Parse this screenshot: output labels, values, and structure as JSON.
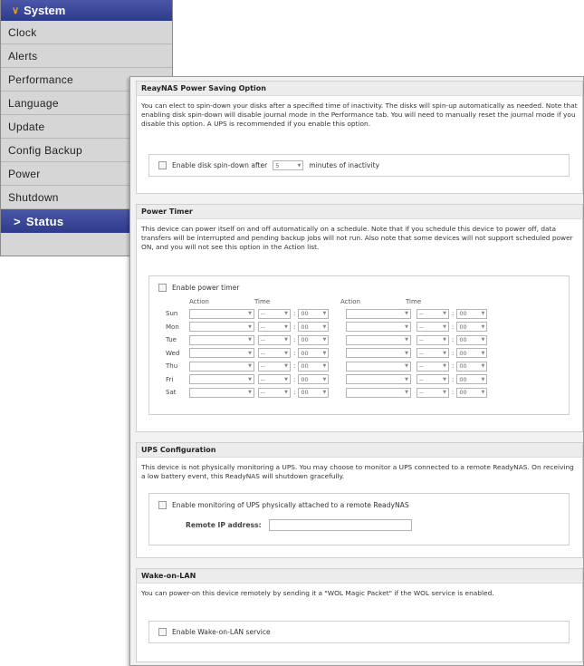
{
  "menu": {
    "header": "System",
    "items": [
      "Clock",
      "Alerts",
      "Performance",
      "Language",
      "Update",
      "Config Backup",
      "Power",
      "Shutdown"
    ],
    "active": "Status"
  },
  "power_saving": {
    "title": "ReayNAS Power Saving Option",
    "description": "You can elect to spin-down your disks after a specified time of inactivity. The disks will spin-up automatically as needed. Note that enabling disk spin-down will disable journal mode in the Performance tab. You will need to manually reset the journal mode if you disable this option. A UPS is recommended if you enable this option.",
    "checkbox_label_pre": "Enable disk spin-down after",
    "minutes_value": "5",
    "checkbox_label_post": "minutes of inactivity"
  },
  "power_timer": {
    "title": "Power Timer",
    "description": "This device can power itself on and off automatically on a schedule. Note that if you schedule this device to power off, data transfers will be interrupted and pending backup jobs will not run. Also note that some devices will not support scheduled power ON, and you will not see this option in the Action list.",
    "checkbox_label": "Enable power timer",
    "col_action": "Action",
    "col_time": "Time",
    "hour_placeholder": "--",
    "minute_value": "00",
    "days": [
      "Sun",
      "Mon",
      "Tue",
      "Wed",
      "Thu",
      "Fri",
      "Sat"
    ]
  },
  "ups": {
    "title": "UPS Configuration",
    "description": "This device is not physically monitoring a UPS. You may choose to monitor a UPS connected to a remote ReadyNAS. On receiving a low battery event, this ReadyNAS will shutdown gracefully.",
    "checkbox_label": "Enable monitoring of UPS physically attached to a remote ReadyNAS",
    "ip_label": "Remote IP address:",
    "ip_value": ""
  },
  "wol": {
    "title": "Wake-on-LAN",
    "description": "You can power-on this device remotely by sending it a \"WOL Magic Packet\" if the WOL service is enabled.",
    "checkbox_label": "Enable Wake-on-LAN service"
  }
}
